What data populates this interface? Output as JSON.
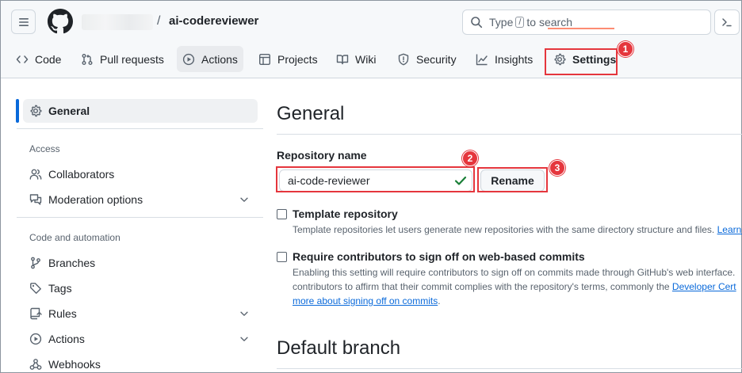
{
  "header": {
    "repo_name": "ai-codereviewer",
    "separator": "/",
    "search": {
      "prefix": "Type",
      "key": "/",
      "suffix": "to search"
    }
  },
  "tabs": [
    {
      "label": "Code",
      "icon": "code-icon"
    },
    {
      "label": "Pull requests",
      "icon": "git-pull-request-icon"
    },
    {
      "label": "Actions",
      "icon": "play-icon"
    },
    {
      "label": "Projects",
      "icon": "table-icon"
    },
    {
      "label": "Wiki",
      "icon": "book-icon"
    },
    {
      "label": "Security",
      "icon": "shield-icon"
    },
    {
      "label": "Insights",
      "icon": "graph-icon"
    },
    {
      "label": "Settings",
      "icon": "gear-icon",
      "selected": true
    }
  ],
  "annotations": {
    "badge1": "1",
    "badge2": "2",
    "badge3": "3"
  },
  "sidebar": {
    "general": "General",
    "access_heading": "Access",
    "collaborators": "Collaborators",
    "moderation": "Moderation options",
    "code_heading": "Code and automation",
    "branches": "Branches",
    "tags": "Tags",
    "rules": "Rules",
    "actions": "Actions",
    "webhooks": "Webhooks"
  },
  "main": {
    "title": "General",
    "repo_name_label": "Repository name",
    "repo_name_value": "ai-code-reviewer",
    "rename_label": "Rename",
    "template": {
      "title": "Template repository",
      "desc": "Template repositories let users generate new repositories with the same directory structure and files.",
      "link": "Learn m"
    },
    "signoff": {
      "title": "Require contributors to sign off on web-based commits",
      "desc1": "Enabling this setting will require contributors to sign off on commits made through GitHub's web interface.",
      "desc2": "contributors to affirm that their commit complies with the repository's terms, commonly the",
      "link1": "Developer Cert",
      "link2": "more about signing off on commits",
      "desc3_end": "."
    },
    "default_branch_title": "Default branch"
  },
  "colors": {
    "accent": "#0969da",
    "annotation_red": "#e5363d",
    "success_green": "#1a7f37",
    "tab_underline": "#fd8c73"
  }
}
